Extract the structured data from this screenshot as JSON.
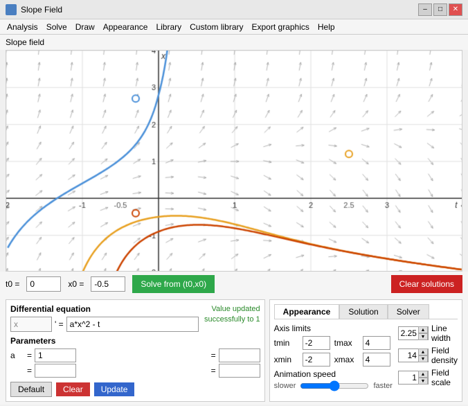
{
  "titlebar": {
    "title": "Slope Field",
    "icon": "chart-icon",
    "minimize_label": "–",
    "maximize_label": "□",
    "close_label": "✕"
  },
  "menubar": {
    "items": [
      "Analysis",
      "Solve",
      "Draw",
      "Appearance",
      "Library",
      "Custom library",
      "Export graphics",
      "Help"
    ]
  },
  "graph": {
    "label": "Slope field",
    "xlabel": "t",
    "ylabel": "x"
  },
  "solve_bar": {
    "t0_label": "t0 =",
    "t0_value": "0",
    "x0_label": "x0 =",
    "x0_value": "-0.5",
    "solve_btn": "Solve from (t0,x0)",
    "clear_btn": "Clear solutions"
  },
  "diff_eq": {
    "section_title": "Differential equation",
    "var_name": "x",
    "derivative": "' =",
    "equation": "a*x^2 - t",
    "value_updated": "Value updated\nsuccessfully to 1"
  },
  "parameters": {
    "section_title": "Parameters",
    "params": [
      {
        "name": "a",
        "eq": "=",
        "value": "1",
        "value2": "=",
        "val2": ""
      },
      {
        "name": "",
        "eq": "=",
        "value": "",
        "value2": "=",
        "val2": ""
      }
    ]
  },
  "bottom_buttons": {
    "default_label": "Default",
    "clear_label": "Clear",
    "update_label": "Update"
  },
  "appearance_panel": {
    "tabs": [
      "Appearance",
      "Solution",
      "Solver"
    ],
    "active_tab": "Appearance",
    "axis_limits": {
      "tmin_label": "tmin",
      "tmin_value": "-2",
      "tmax_label": "tmax",
      "tmax_value": "4",
      "xmin_label": "xmin",
      "xmin_value": "-2",
      "xmax_label": "xmax",
      "xmax_value": "4"
    },
    "line_width": {
      "label": "Line width",
      "value": "2.25"
    },
    "field_density": {
      "label": "Field density",
      "value": "14"
    },
    "field_scale": {
      "label": "Field scale",
      "value": "1"
    },
    "animation_speed": {
      "label": "Animation speed",
      "slower": "slower",
      "faster": "faster"
    }
  },
  "colors": {
    "blue_curve": "#4a90d9",
    "orange_curve": "#e8a020",
    "red_curve": "#cc3300",
    "solve_btn": "#2ea84a",
    "clear_sol_btn": "#cc2222",
    "update_btn": "#3366cc",
    "clear_btn": "#cc3333",
    "value_updated": "#2a8a2a"
  }
}
